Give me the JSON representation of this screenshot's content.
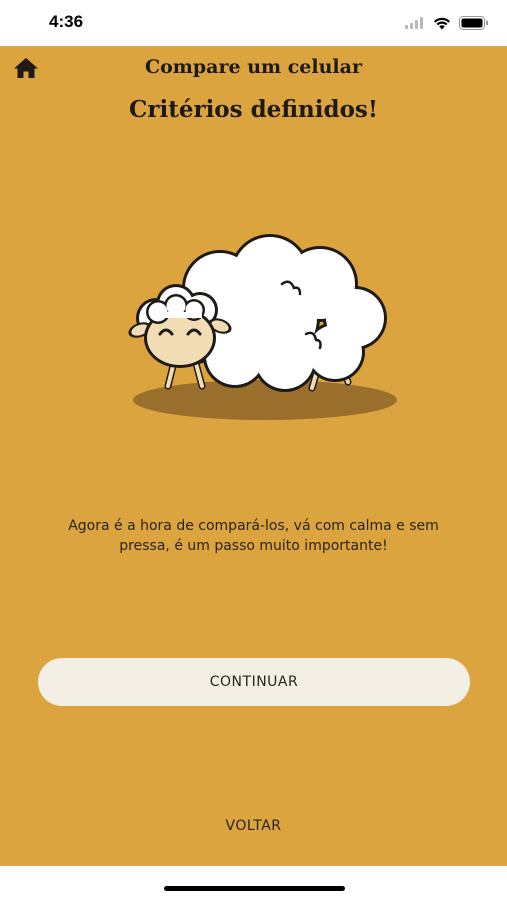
{
  "status_bar": {
    "time": "4:36"
  },
  "header": {
    "title": "Compare um celular",
    "subtitle": "Critérios definidos!"
  },
  "main": {
    "message_line1": "Agora é a hora de compará-los, vá com calma e sem",
    "message_line2": "pressa, é um passo muito importante!"
  },
  "actions": {
    "continue_label": "CONTINUAR",
    "back_label": "VOLTAR"
  },
  "colors": {
    "background": "#dca43e",
    "button_bg": "#f3efe4",
    "text": "#1d1a17"
  },
  "icons": {
    "home": "home-icon",
    "illustration": "sheep-illustration"
  }
}
